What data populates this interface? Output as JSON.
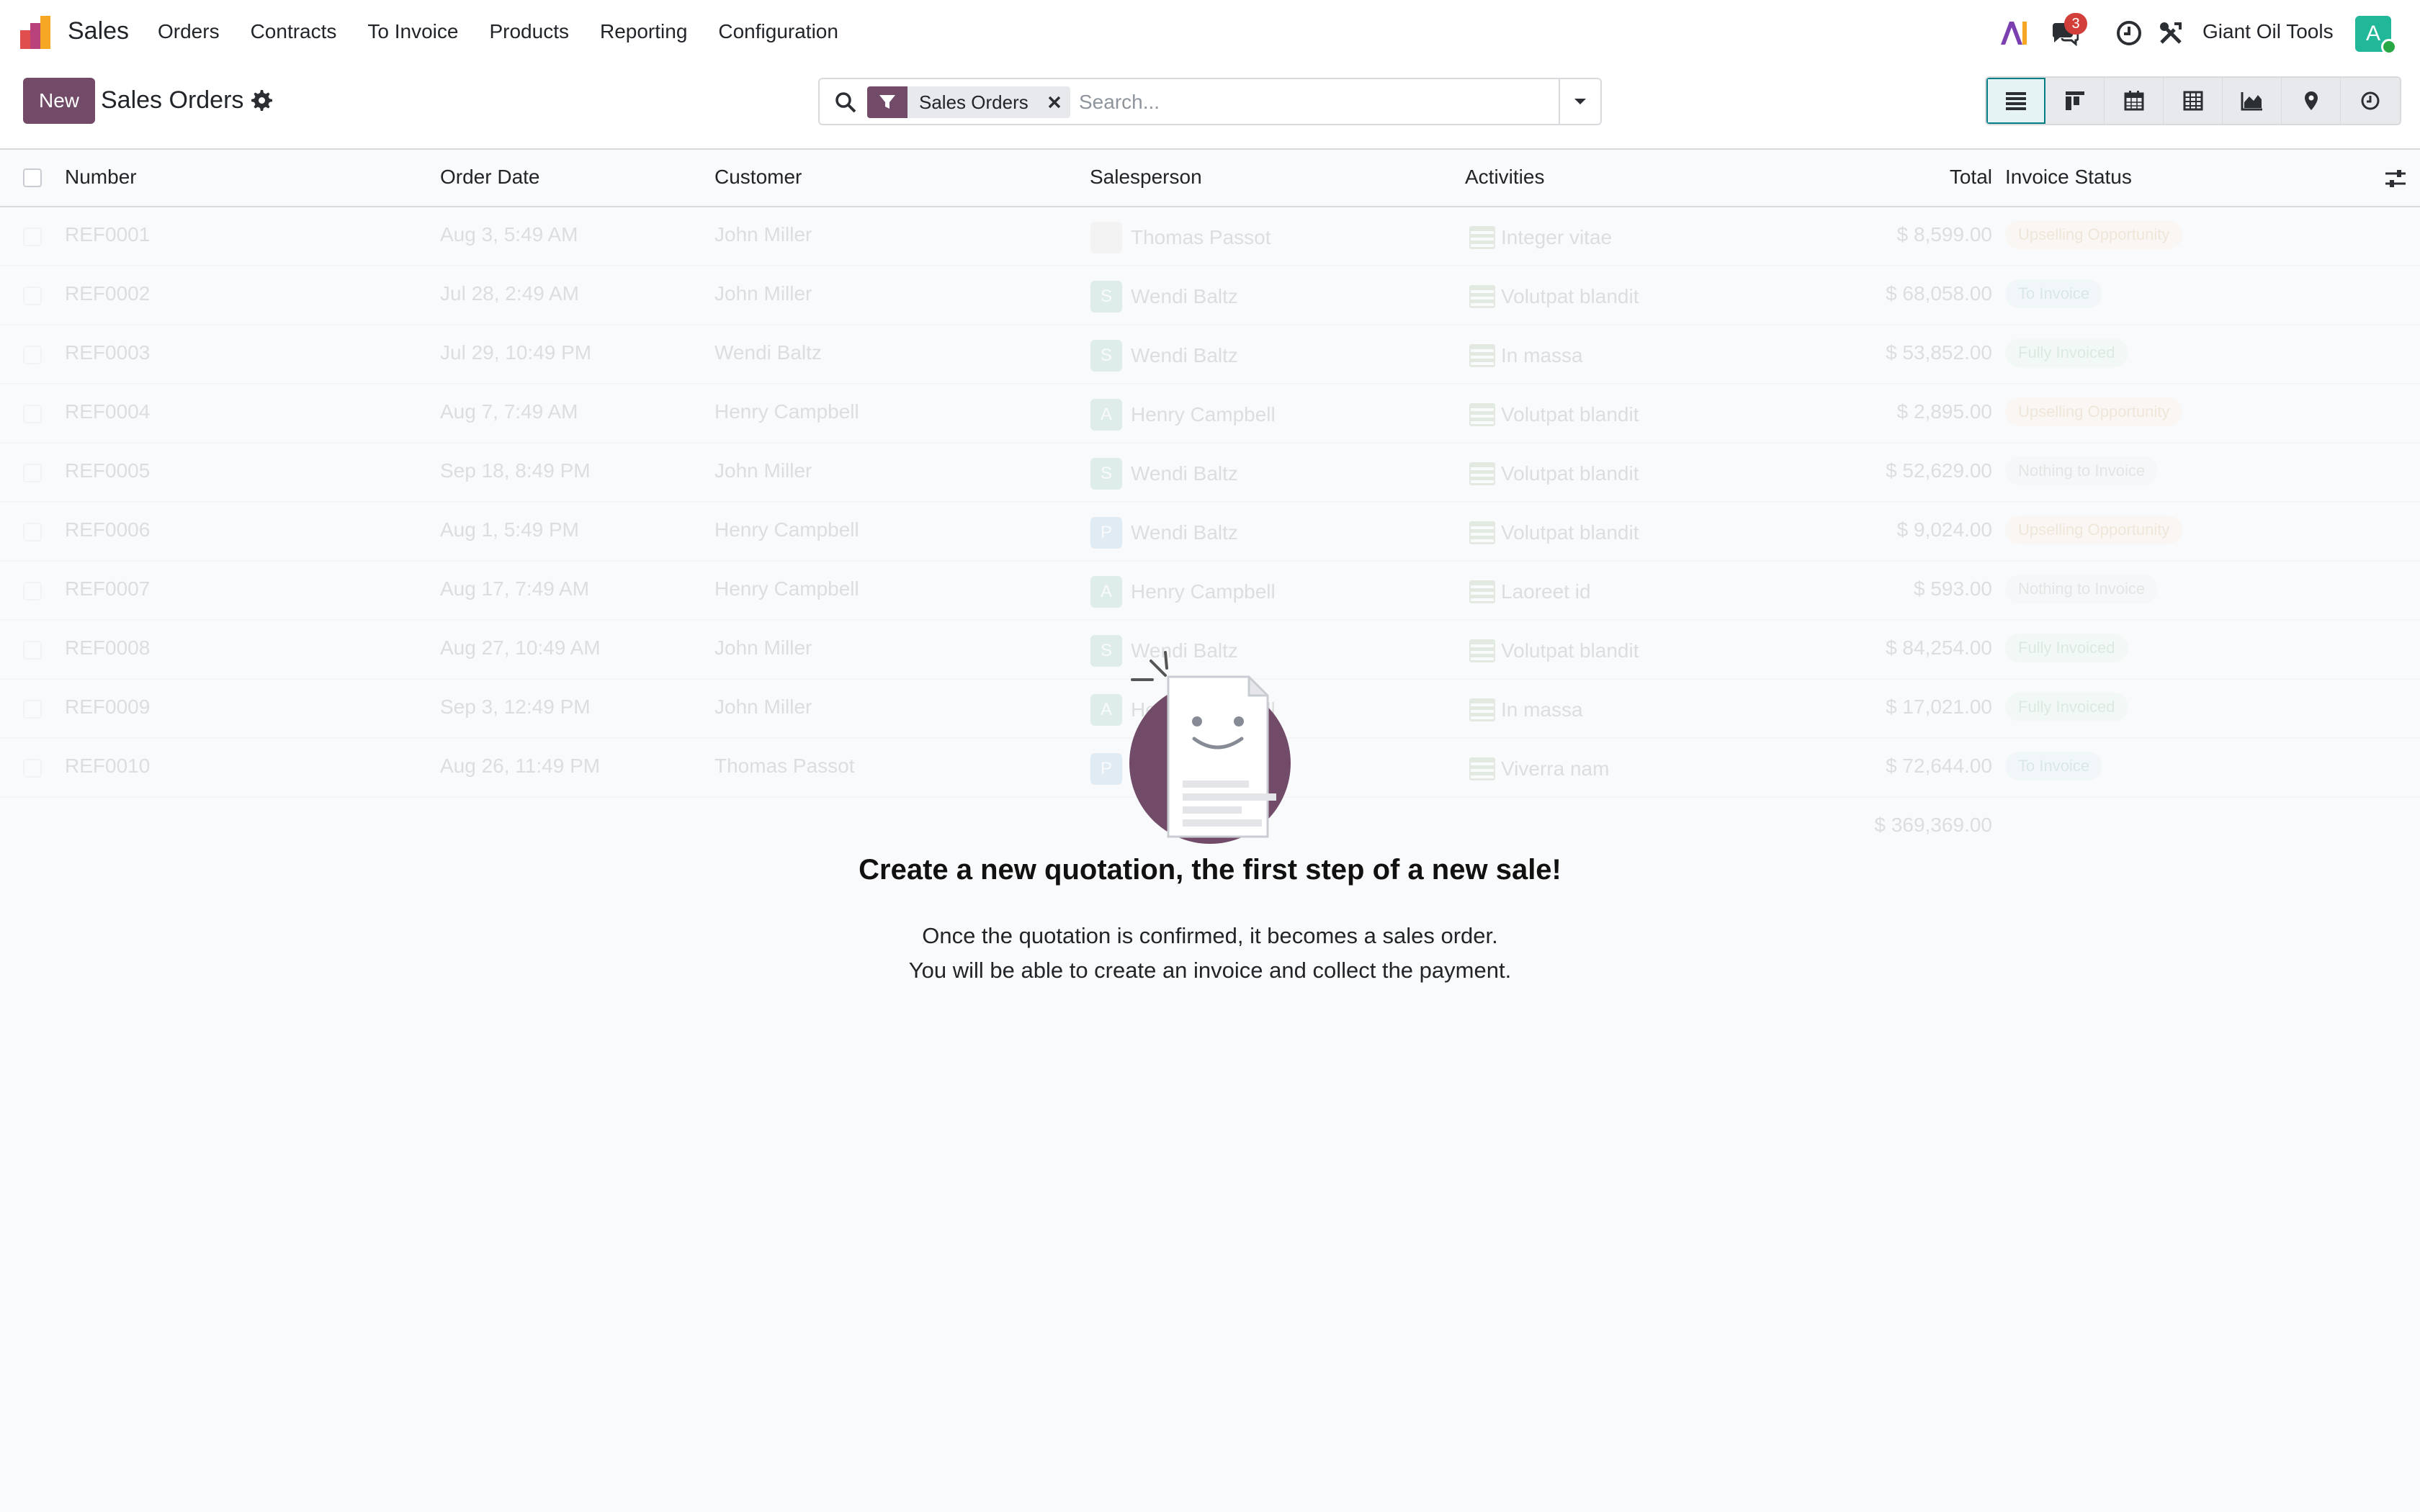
{
  "app": {
    "name": "Sales"
  },
  "menu": [
    "Orders",
    "Contracts",
    "To Invoice",
    "Products",
    "Reporting",
    "Configuration"
  ],
  "navbar": {
    "messages_count": "3",
    "company": "Giant Oil Tools",
    "user_initial": "A"
  },
  "control": {
    "new_label": "New",
    "title": "Sales Orders",
    "facet_label": "Sales Orders",
    "search_placeholder": "Search..."
  },
  "columns": {
    "number": "Number",
    "order_date": "Order Date",
    "customer": "Customer",
    "salesperson": "Salesperson",
    "activities": "Activities",
    "total": "Total",
    "invoice_status": "Invoice Status"
  },
  "rows": [
    {
      "number": "REF0001",
      "date": "Aug 3, 5:49 AM",
      "customer": "John Miller",
      "salesperson": "Thomas Passot",
      "sp_initial": "",
      "activity": "Integer vitae",
      "total": "$ 8,599.00",
      "status": "Upselling Opportunity"
    },
    {
      "number": "REF0002",
      "date": "Jul 28, 2:49 AM",
      "customer": "John Miller",
      "salesperson": "Wendi Baltz",
      "sp_initial": "S",
      "activity": "Volutpat blandit",
      "total": "$ 68,058.00",
      "status": "To Invoice"
    },
    {
      "number": "REF0003",
      "date": "Jul 29, 10:49 PM",
      "customer": "Wendi Baltz",
      "salesperson": "Wendi Baltz",
      "sp_initial": "S",
      "activity": "In massa",
      "total": "$ 53,852.00",
      "status": "Fully Invoiced"
    },
    {
      "number": "REF0004",
      "date": "Aug 7, 7:49 AM",
      "customer": "Henry Campbell",
      "salesperson": "Henry Campbell",
      "sp_initial": "A",
      "activity": "Volutpat blandit",
      "total": "$ 2,895.00",
      "status": "Upselling Opportunity"
    },
    {
      "number": "REF0005",
      "date": "Sep 18, 8:49 PM",
      "customer": "John Miller",
      "salesperson": "Wendi Baltz",
      "sp_initial": "S",
      "activity": "Volutpat blandit",
      "total": "$ 52,629.00",
      "status": "Nothing to Invoice"
    },
    {
      "number": "REF0006",
      "date": "Aug 1, 5:49 PM",
      "customer": "Henry Campbell",
      "salesperson": "Wendi Baltz",
      "sp_initial": "P",
      "activity": "Volutpat blandit",
      "total": "$ 9,024.00",
      "status": "Upselling Opportunity"
    },
    {
      "number": "REF0007",
      "date": "Aug 17, 7:49 AM",
      "customer": "Henry Campbell",
      "salesperson": "Henry Campbell",
      "sp_initial": "A",
      "activity": "Laoreet id",
      "total": "$ 593.00",
      "status": "Nothing to Invoice"
    },
    {
      "number": "REF0008",
      "date": "Aug 27, 10:49 AM",
      "customer": "John Miller",
      "salesperson": "Wendi Baltz",
      "sp_initial": "S",
      "activity": "Volutpat blandit",
      "total": "$ 84,254.00",
      "status": "Fully Invoiced"
    },
    {
      "number": "REF0009",
      "date": "Sep 3, 12:49 PM",
      "customer": "John Miller",
      "salesperson": "Henry Campbell",
      "sp_initial": "A",
      "activity": "In massa",
      "total": "$ 17,021.00",
      "status": "Fully Invoiced"
    },
    {
      "number": "REF0010",
      "date": "Aug 26, 11:49 PM",
      "customer": "Thomas Passot",
      "salesperson": "Wendi Baltz",
      "sp_initial": "P",
      "activity": "Viverra nam",
      "total": "$ 72,644.00",
      "status": "To Invoice"
    }
  ],
  "grand_total": "$ 369,369.00",
  "empty": {
    "title": "Create a new quotation, the first step of a new sale!",
    "line1": "Once the quotation is confirmed, it becomes a sales order.",
    "line2": "You will be able to create an invoice and collect the payment."
  },
  "colors": {
    "brand": "#714b67",
    "accent": "#017e84"
  }
}
